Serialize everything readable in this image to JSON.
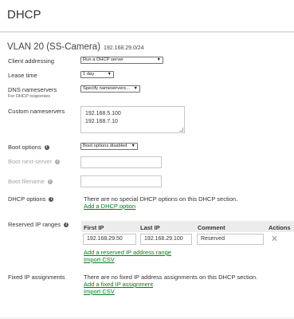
{
  "page": {
    "title": "DHCP"
  },
  "vlan": {
    "title": "VLAN 20 (SS-Camera)",
    "subnet": "192.168.29.0/24"
  },
  "client_addressing": {
    "label": "Client addressing",
    "value": "Run a DHCP server"
  },
  "lease_time": {
    "label": "Lease time",
    "value": "1 day"
  },
  "dns": {
    "label": "DNS nameservers",
    "sublabel": "For DHCP responses",
    "value": "Specify nameservers..."
  },
  "custom_ns": {
    "label": "Custom nameservers",
    "lines": [
      "192.168.5.100",
      "192.168.7.10"
    ]
  },
  "boot_options": {
    "label": "Boot options",
    "value": "Boot options disabled"
  },
  "boot_next_server": {
    "label": "Boot next-server",
    "value": ""
  },
  "boot_filename": {
    "label": "Boot filename",
    "value": ""
  },
  "dhcp_options": {
    "label": "DHCP options",
    "message": "There are no special DHCP options on this DHCP section.",
    "add_link": "Add a DHCP option"
  },
  "reserved": {
    "label": "Reserved IP ranges",
    "columns": [
      "First IP",
      "Last IP",
      "Comment",
      "Actions"
    ],
    "rows": [
      {
        "first_ip": "192.168.29.50",
        "last_ip": "192.168.29.100",
        "comment": "Reserved",
        "action_icon": "x-icon"
      }
    ],
    "add_link": "Add a reserved IP address range",
    "import_link": "Import CSV"
  },
  "fixed": {
    "label": "Fixed IP assignments",
    "message": "There are no fixed IP address assignments on this DHCP section.",
    "add_link": "Add a fixed IP assignment",
    "import_link": "Import CSV"
  },
  "colors": {
    "link": "#0a7a1f",
    "header_bg": "#ececec",
    "text": "#333333"
  }
}
